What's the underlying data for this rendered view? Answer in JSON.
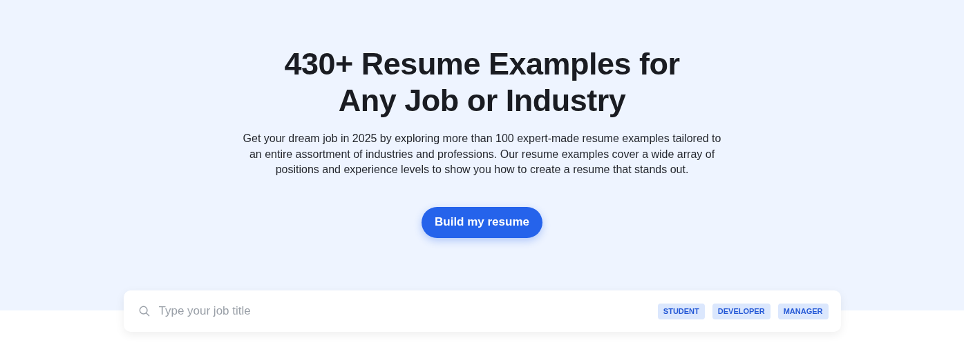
{
  "hero": {
    "title": "430+ Resume Examples for Any Job or Industry",
    "description": "Get your dream job in 2025 by exploring more than 100 expert-made resume examples tailored to an entire assortment of industries and professions. Our resume examples cover a wide array of positions and experience levels to show you how to create a resume that stands out.",
    "button": "Build my resume"
  },
  "search": {
    "placeholder": "Type your job title",
    "tags": [
      "STUDENT",
      "DEVELOPER",
      "MANAGER"
    ]
  }
}
